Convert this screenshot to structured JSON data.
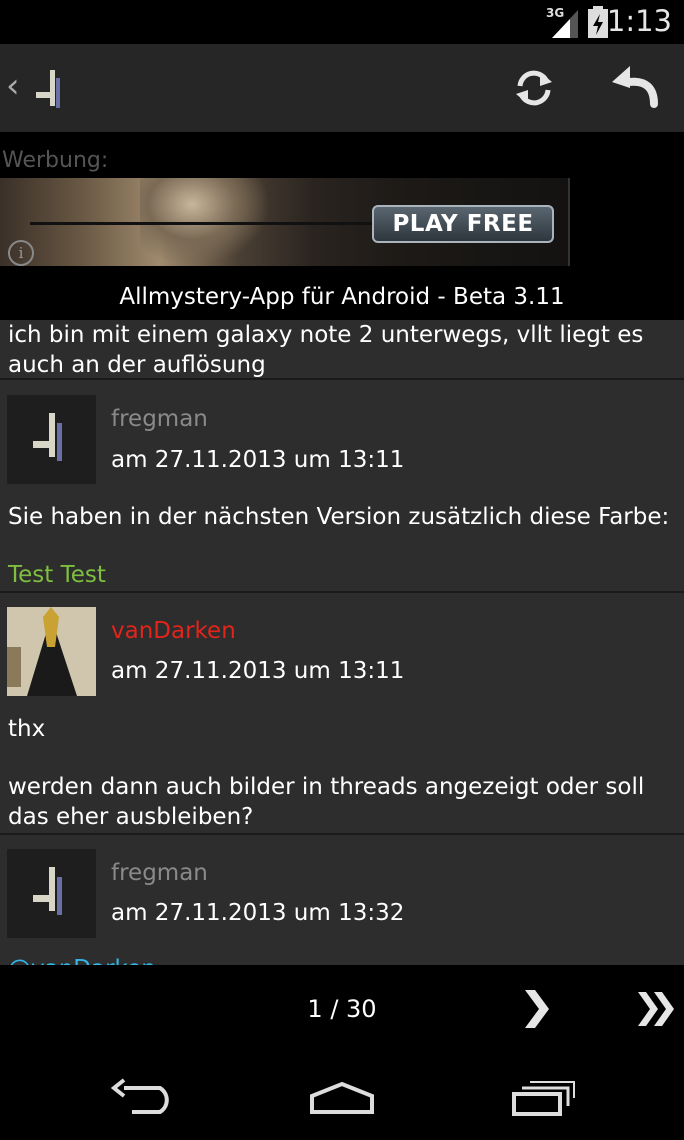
{
  "status_bar": {
    "network": "3G",
    "time": "1:13"
  },
  "action_bar": {
    "back": "‹"
  },
  "ad": {
    "label": "Werbung:",
    "button": "PLAY FREE",
    "info": "i"
  },
  "app_title": "Allmystery-App für Android - Beta 3.11",
  "posts": [
    {
      "text": "ich bin mit einem galaxy note 2 unterwegs, vllt liegt es auch an der auflösung"
    },
    {
      "user": "fregman",
      "date": "am 27.11.2013 um 13:11",
      "text": "Sie haben in der nächsten Version zusätzlich diese Farbe:",
      "colored_text": "Test Test"
    },
    {
      "user": "vanDarken",
      "date": "am 27.11.2013 um 13:11",
      "text1": "thx",
      "text2": "werden dann auch bilder in threads angezeigt oder soll das eher ausbleiben?"
    },
    {
      "user": "fregman",
      "date": "am 27.11.2013 um 13:32",
      "partial": "@vanDarken"
    }
  ],
  "pager": {
    "indicator": "1 / 30",
    "next": "❯",
    "last": "»"
  },
  "colors": {
    "username_gray": "#8a8a8a",
    "username_red": "#e3241b",
    "green_text": "#7fbf3f",
    "mention_blue": "#33b5e5"
  }
}
